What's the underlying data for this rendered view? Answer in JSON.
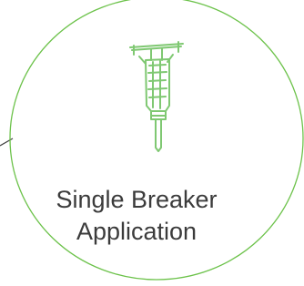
{
  "node": {
    "label_line1": "Single Breaker",
    "label_line2": "Application",
    "icon": "jackhammer-icon",
    "circle_stroke_color": "#6cc24a",
    "icon_color": "#7fc872",
    "connector_color": "#404040",
    "text_color": "#3b3b3b"
  }
}
